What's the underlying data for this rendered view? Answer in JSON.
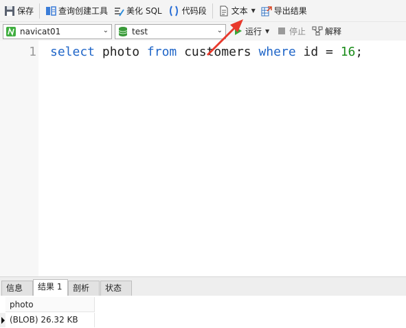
{
  "toolbar": {
    "save": "保存",
    "query_builder": "查询创建工具",
    "beautify_sql": "美化 SQL",
    "code_snippet": "代码段",
    "text": "文本",
    "export_results": "导出结果",
    "run": "运行",
    "stop": "停止",
    "explain": "解释"
  },
  "connection": {
    "selected": "navicat01"
  },
  "database": {
    "selected": "test"
  },
  "editor": {
    "line_number": "1",
    "tokens": [
      "select",
      " photo ",
      "from",
      " customers ",
      "where",
      " id = ",
      "16",
      ";"
    ]
  },
  "tabs": [
    "信息",
    "结果 1",
    "剖析",
    "状态"
  ],
  "result": {
    "column": "photo",
    "rows": [
      "(BLOB) 26.32 KB"
    ]
  },
  "colors": {
    "keyword": "#2066c8",
    "number": "#1a8c1a",
    "arrow": "#e8392c"
  },
  "icons": [
    "save-icon",
    "query-builder-icon",
    "beautify-icon",
    "code-snippet-icon",
    "text-icon",
    "export-icon",
    "connection-icon",
    "database-icon",
    "run-icon",
    "stop-icon",
    "explain-icon"
  ]
}
